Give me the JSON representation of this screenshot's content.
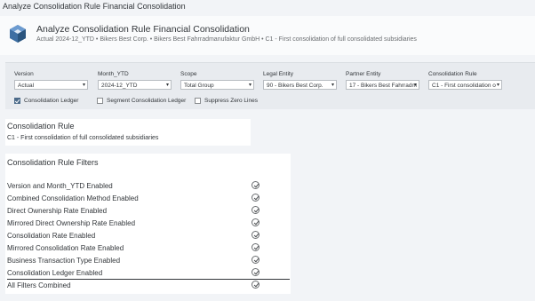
{
  "window": {
    "title": "Analyze Consolidation Rule Financial Consolidation"
  },
  "header": {
    "icon": "consolidation-cube-icon",
    "title": "Analyze Consolidation Rule Financial Consolidation",
    "subtitle": "Actual 2024-12_YTD • Bikers Best Corp. • Bikers Best Fahrradmanufaktur GmbH • C1 - First consolidation of full consolidated subsidiaries"
  },
  "filters": [
    {
      "label": "Version",
      "value": "Actual"
    },
    {
      "label": "Month_YTD",
      "value": "2024-12_YTD"
    },
    {
      "label": "Scope",
      "value": "Total Group"
    },
    {
      "label": "Legal Entity",
      "value": "90 - Bikers Best Corp."
    },
    {
      "label": "Partner Entity",
      "value": "17 - Bikers Best Fahrradm"
    },
    {
      "label": "Consolidation Rule",
      "value": "C1 - First consolidation o"
    }
  ],
  "checkboxes": [
    {
      "label": "Consolidation Ledger",
      "checked": true
    },
    {
      "label": "Segment Consolidation Ledger",
      "checked": false
    },
    {
      "label": "Suppress Zero Lines",
      "checked": false
    }
  ],
  "rule_card": {
    "title": "Consolidation Rule",
    "value": "C1 - First consolidation of full consolidated subsidiaries"
  },
  "filters_card": {
    "title": "Consolidation Rule Filters",
    "rows": [
      {
        "label": "Version and Month_YTD Enabled",
        "status": "check-circle-icon"
      },
      {
        "label": "Combined Consolidation Method Enabled",
        "status": "check-circle-icon"
      },
      {
        "label": "Direct Ownership Rate Enabled",
        "status": "check-circle-icon"
      },
      {
        "label": "Mirrored Direct Ownership Rate Enabled",
        "status": "check-circle-icon"
      },
      {
        "label": "Consolidation Rate Enabled",
        "status": "check-circle-icon"
      },
      {
        "label": "Mirrored Consolidation Rate Enabled",
        "status": "check-circle-icon"
      },
      {
        "label": "Business Transaction Type Enabled",
        "status": "check-circle-icon"
      },
      {
        "label": "Consolidation Ledger Enabled",
        "status": "check-circle-icon"
      },
      {
        "label": "All Filters Combined",
        "status": "check-circle-icon"
      }
    ]
  }
}
